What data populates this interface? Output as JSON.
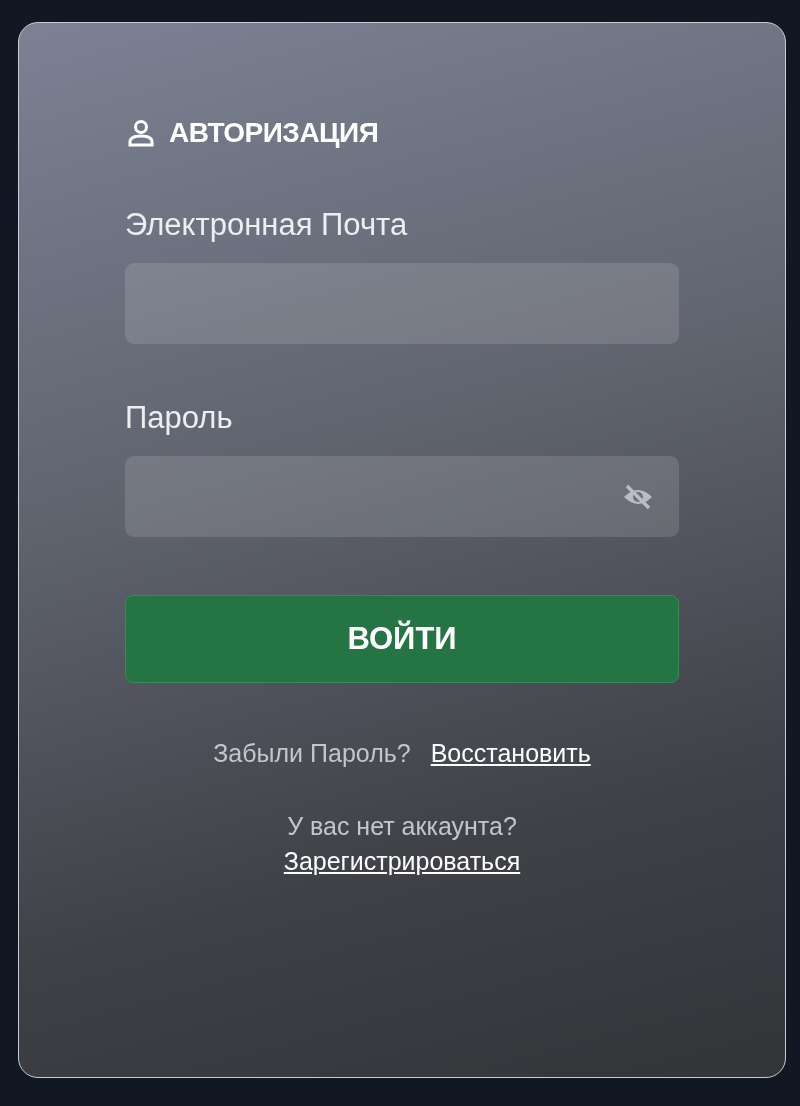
{
  "title": "АВТОРИЗАЦИЯ",
  "fields": [
    {
      "label": "Электронная Почта",
      "kind": "email"
    },
    {
      "label": "Пароль",
      "kind": "password",
      "password_visible": false
    }
  ],
  "submit_button": "ВОЙТИ",
  "forgot": {
    "question": "Забыли Пароль?",
    "link": "Восстановить"
  },
  "signup": {
    "question": "У вас нет аккаунта?",
    "link": "Зарегистрироваться"
  }
}
